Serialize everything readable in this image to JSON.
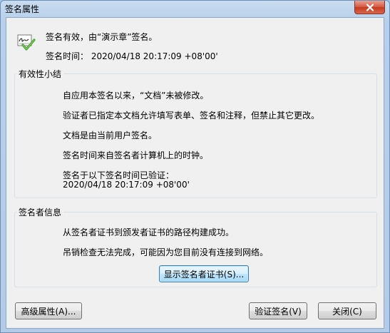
{
  "window": {
    "title": "签名属性"
  },
  "header": {
    "status": "签名有效，由“演示章”签名。",
    "time": "签名时间： 2020/04/18 20:17:09 +08'00'"
  },
  "validity_summary": {
    "legend": "有效性小结",
    "lines": [
      "自应用本签名以来，“文档”未被修改。",
      "验证者已指定本文档允许填写表单、签名和注释，但禁止其它更改。",
      "文档是由当前用户签名。",
      "签名时间来自签名者计算机上的时钟。",
      "签名于以下签名时间已验证：",
      "2020/04/18 20:17:09 +08'00'"
    ]
  },
  "signer_info": {
    "legend": "签名者信息",
    "lines": [
      "从签名者证书到颁发者证书的路径构建成功。",
      "吊销检查无法完成，可能因为您目前没有连接到网络。"
    ],
    "show_cert_button": "显示签名者证书(S)..."
  },
  "buttons": {
    "advanced": "高级属性(A)...",
    "validate": "验证签名(V)",
    "close": "关闭(C)"
  },
  "icons": {
    "signature": "signature-valid-icon",
    "close": "close-icon"
  }
}
